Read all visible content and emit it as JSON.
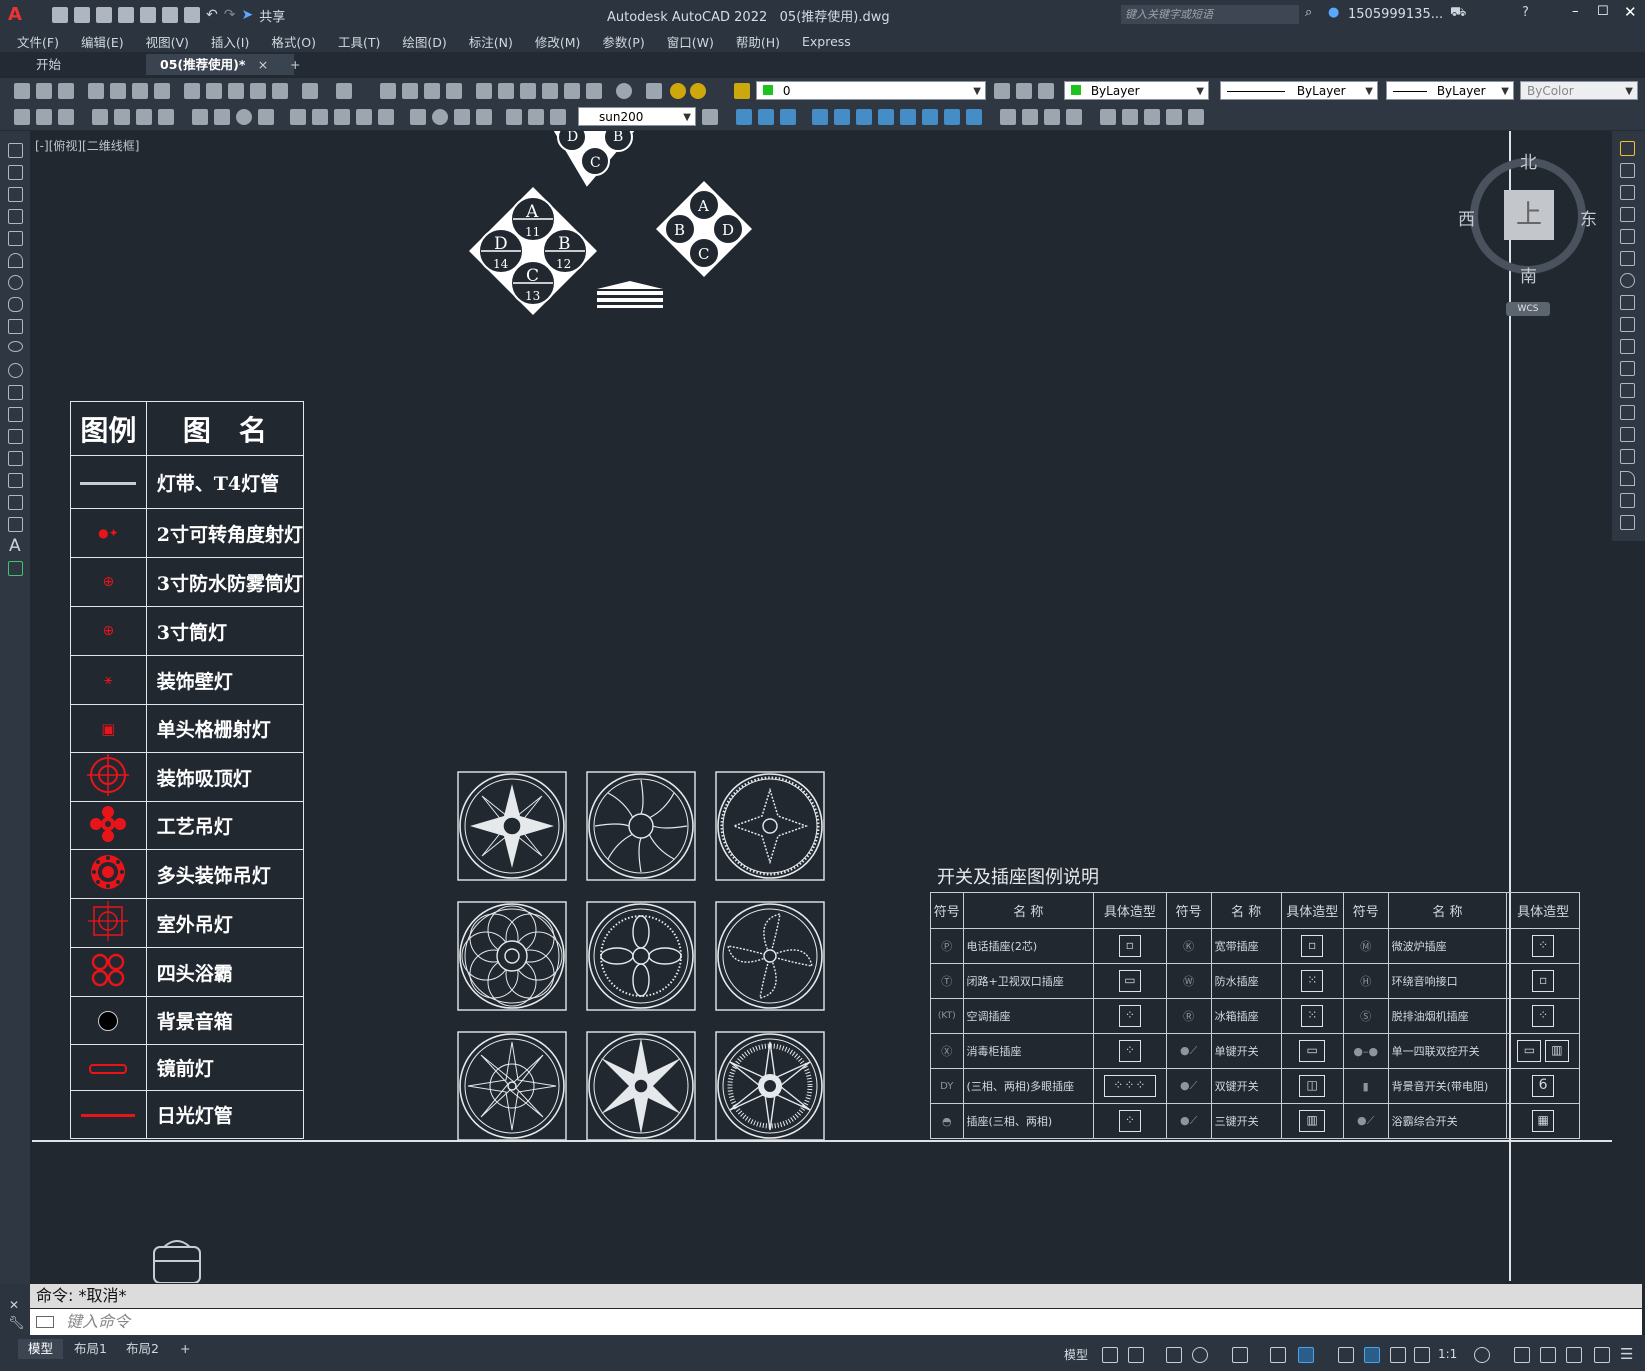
{
  "app": {
    "title": "Autodesk AutoCAD 2022",
    "file": "05(推荐使用).dwg",
    "share": "共享",
    "search_placeholder": "键入关键字或短语",
    "user": "1505999135..."
  },
  "menu": [
    "文件(F)",
    "编辑(E)",
    "视图(V)",
    "插入(I)",
    "格式(O)",
    "工具(T)",
    "绘图(D)",
    "标注(N)",
    "修改(M)",
    "参数(P)",
    "窗口(W)",
    "帮助(H)",
    "Express"
  ],
  "tabs": {
    "start": "开始",
    "active": "05(推荐使用)*",
    "close": "×",
    "add": "+"
  },
  "toolbar": {
    "layer": "0",
    "color": "ByLayer",
    "linetype": "ByLayer",
    "lineweight": "ByLayer",
    "plotstyle": "ByColor",
    "dimstyle": "sun200"
  },
  "viewport_label": "[-][俯视][二维线框]",
  "viewcube": {
    "north": "北",
    "south": "南",
    "east": "东",
    "west": "西",
    "face": "上",
    "wcs": "WCS"
  },
  "lighting_legend": {
    "header_symbol": "图例",
    "header_name": "图　名",
    "rows": [
      "灯带、T4灯管",
      "2寸可转角度射灯",
      "3寸防水防雾筒灯",
      "3寸筒灯",
      "装饰壁灯",
      "单头格栅射灯",
      "装饰吸顶灯",
      "工艺吊灯",
      "多头装饰吊灯",
      "室外吊灯",
      "四头浴霸",
      "背景音箱",
      "镜前灯",
      "日光灯管"
    ]
  },
  "diamonds": {
    "big": {
      "top": "A",
      "right": "B",
      "bottom": "C",
      "left": "D",
      "n_top": "11",
      "n_right": "12",
      "n_bottom": "13",
      "n_left": "14"
    },
    "small": {
      "top": "A",
      "right": "D",
      "bottom": "C",
      "left": "B"
    },
    "partial": {
      "left": "D",
      "right": "B",
      "bottom": "C"
    }
  },
  "switch_legend": {
    "title": "开关及插座图例说明",
    "headers": [
      "符号",
      "名 称",
      "具体造型",
      "符号",
      "名 称",
      "具体造型",
      "符号",
      "名 称",
      "具体造型"
    ],
    "rows": [
      [
        {
          "sym": "P",
          "name": "电话插座(2芯)",
          "model": "▣"
        },
        {
          "sym": "k",
          "name": "宽带插座",
          "model": "▣"
        },
        {
          "sym": "M",
          "name": "微波炉插座",
          "model": "▣"
        }
      ],
      [
        {
          "sym": "T",
          "name": "闭路+卫视双口插座",
          "model": "▣"
        },
        {
          "sym": "W",
          "name": "防水插座",
          "model": "▣"
        },
        {
          "sym": "H",
          "name": "环绕音响接口",
          "model": "▣"
        }
      ],
      [
        {
          "sym": "KT",
          "name": "空调插座",
          "model": "▣"
        },
        {
          "sym": "R",
          "name": "冰箱插座",
          "model": "▣"
        },
        {
          "sym": "S",
          "name": "脱排油烟机插座",
          "model": "▣"
        }
      ],
      [
        {
          "sym": "X",
          "name": "消毒柜插座",
          "model": "▣"
        },
        {
          "sym": "",
          "name": "单键开关",
          "model": "▢"
        },
        {
          "sym": "",
          "name": "单一四联双控开关",
          "model": "▢"
        }
      ],
      [
        {
          "sym": "DY",
          "name": "(三相、两相)多眼插座",
          "model": "▣"
        },
        {
          "sym": "",
          "name": "双键开关",
          "model": "▢"
        },
        {
          "sym": "",
          "name": "背景音开关(带电阻)",
          "model": "6"
        }
      ],
      [
        {
          "sym": "",
          "name": "插座(三相、两相)",
          "model": "▣"
        },
        {
          "sym": "",
          "name": "三键开关",
          "model": "▢"
        },
        {
          "sym": "",
          "name": "浴霸综合开关",
          "model": "▦"
        }
      ]
    ]
  },
  "command": {
    "history": "命令: *取消*",
    "placeholder": "键入命令"
  },
  "layout_tabs": [
    "模型",
    "布局1",
    "布局2",
    "+"
  ],
  "status": {
    "model": "模型",
    "scale": "1:1"
  },
  "colors": {
    "background": "#212830",
    "accent_red": "#e8141a",
    "layer_green": "#1ec31e"
  }
}
